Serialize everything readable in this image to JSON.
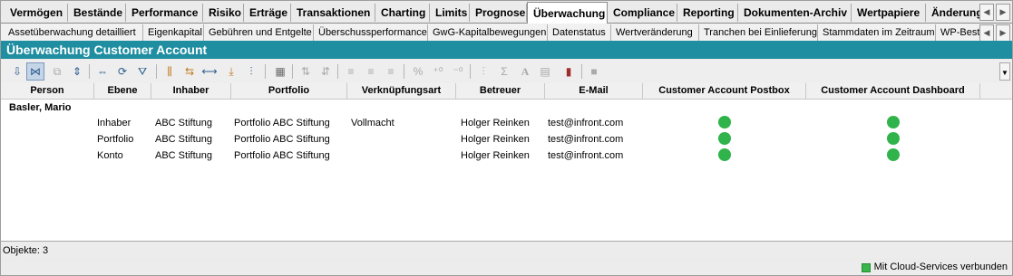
{
  "tabs_main": [
    {
      "label": "Vermögen"
    },
    {
      "label": "Bestände"
    },
    {
      "label": "Performance"
    },
    {
      "label": "Risiko"
    },
    {
      "label": "Erträge"
    },
    {
      "label": "Transaktionen"
    },
    {
      "label": "Charting"
    },
    {
      "label": "Limits"
    },
    {
      "label": "Prognose"
    },
    {
      "label": "Überwachung"
    },
    {
      "label": "Compliance"
    },
    {
      "label": "Reporting"
    },
    {
      "label": "Dokumenten-Archiv"
    },
    {
      "label": "Wertpapiere"
    },
    {
      "label": "Änderung"
    }
  ],
  "tabs_sub": [
    {
      "label": "Assetüberwachung detailliert"
    },
    {
      "label": "Eigenkapital"
    },
    {
      "label": "Gebühren und Entgelte"
    },
    {
      "label": "Überschussperformance"
    },
    {
      "label": "GwG-Kapitalbewegungen"
    },
    {
      "label": "Datenstatus"
    },
    {
      "label": "Wertveränderung"
    },
    {
      "label": "Tranchen bei Einlieferung"
    },
    {
      "label": "Stammdaten im Zeitraum"
    },
    {
      "label": "WP-Best"
    }
  ],
  "title": "Überwachung Customer Account",
  "table": {
    "columns": [
      "Person",
      "Ebene",
      "Inhaber",
      "Portfolio",
      "Verknüpfungsart",
      "Betreuer",
      "E-Mail",
      "Customer Account Postbox",
      "Customer Account Dashboard"
    ],
    "group_label": "Basler, Mario",
    "rows": [
      {
        "ebene": "Inhaber",
        "inhaber": "ABC Stiftung",
        "portfolio": "Portfolio ABC Stiftung",
        "verknuepfungsart": "Vollmacht",
        "betreuer": "Holger Reinken",
        "email": "test@infront.com",
        "postbox": "green",
        "dashboard": "green"
      },
      {
        "ebene": "Portfolio",
        "inhaber": "ABC Stiftung",
        "portfolio": "Portfolio ABC Stiftung",
        "verknuepfungsart": "",
        "betreuer": "Holger Reinken",
        "email": "test@infront.com",
        "postbox": "green",
        "dashboard": "green"
      },
      {
        "ebene": "Konto",
        "inhaber": "ABC Stiftung",
        "portfolio": "Portfolio ABC Stiftung",
        "verknuepfungsart": "",
        "betreuer": "Holger Reinken",
        "email": "test@infront.com",
        "postbox": "green",
        "dashboard": "green"
      }
    ]
  },
  "status": {
    "objects": "Objekte: 3",
    "cloud": "Mit Cloud-Services verbunden"
  },
  "colors": {
    "accent": "#1f8ea1",
    "status_green": "#2fb34a"
  }
}
